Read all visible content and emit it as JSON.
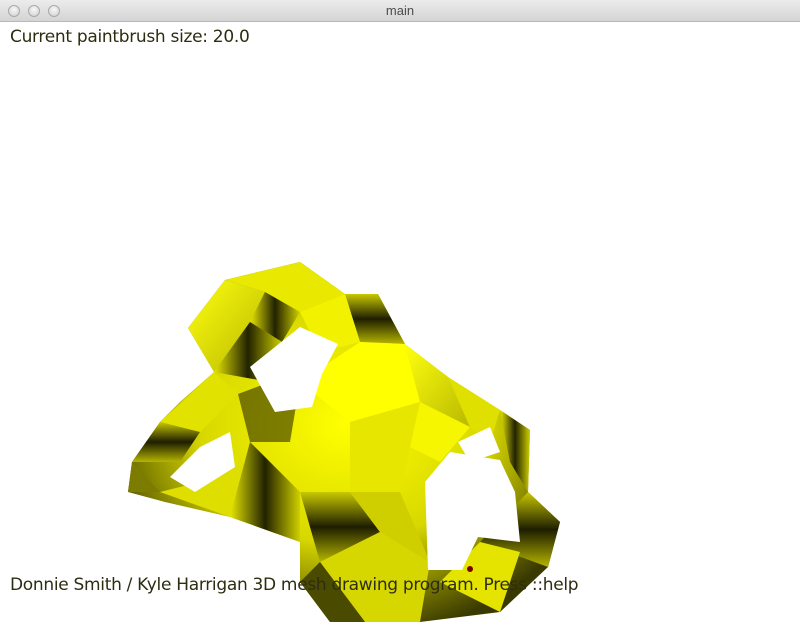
{
  "window": {
    "title": "main"
  },
  "overlay": {
    "brush_status": "Current paintbrush size: 20.0",
    "footer": "Donnie Smith / Kyle Harrigan 3D mesh drawing program.  Press ::help"
  },
  "colors": {
    "mesh_yellow": "#f0f000",
    "mesh_shadow": "#1a1a00",
    "cursor_dot": "#7a0000",
    "text": "#2d2d12"
  }
}
